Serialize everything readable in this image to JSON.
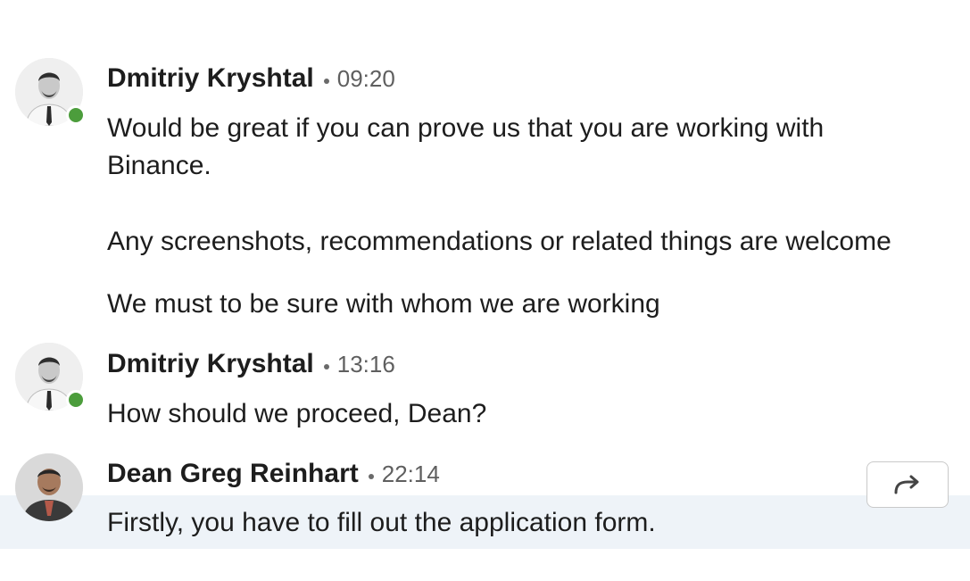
{
  "messages": [
    {
      "sender": "Dmitriy Kryshtal",
      "time": "09:20",
      "online": true,
      "lines": [
        "Would be great if you can prove us that you are working with",
        "Binance.",
        "Any screenshots, recommendations or related things are welcome",
        "We must to be sure with whom we are working"
      ]
    },
    {
      "sender": "Dmitriy Kryshtal",
      "time": "13:16",
      "online": true,
      "lines": [
        "How should we proceed, Dean?"
      ]
    },
    {
      "sender": "Dean Greg Reinhart",
      "time": "22:14",
      "online": false,
      "lines": [
        "Firstly, you have to fill out the application form."
      ]
    }
  ],
  "actions": {
    "forward_icon": "forward-arrow-icon"
  },
  "colors": {
    "presence_online": "#4c9d3c",
    "hover_row": "#eef3f8"
  }
}
